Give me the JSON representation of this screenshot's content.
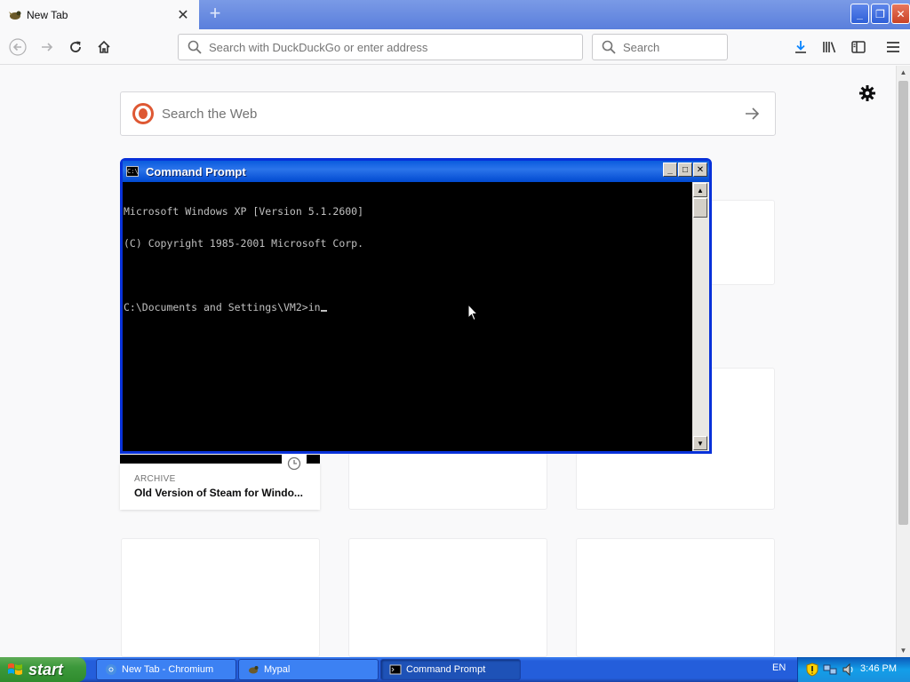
{
  "browser": {
    "tab": {
      "title": "New Tab"
    },
    "urlbar": {
      "placeholder": "Search with DuckDuckGo or enter address"
    },
    "searchbar": {
      "placeholder": "Search"
    }
  },
  "page": {
    "search_placeholder": "Search the Web",
    "card": {
      "tag": "ARCHIVE",
      "title": "Old Version of Steam for Windo..."
    }
  },
  "cmd": {
    "title": "Command Prompt",
    "icon_text": "C:\\",
    "lines": [
      "Microsoft Windows XP [Version 5.1.2600]",
      "(C) Copyright 1985-2001 Microsoft Corp.",
      "",
      "C:\\Documents and Settings\\VM2>in"
    ]
  },
  "taskbar": {
    "start_label": "start",
    "tasks": [
      {
        "label": "New Tab - Chromium",
        "icon": "chromium-icon"
      },
      {
        "label": "Mypal",
        "icon": "mypal-icon"
      },
      {
        "label": "Command Prompt",
        "icon": "cmd-icon"
      }
    ],
    "language": "EN",
    "clock": "3:46 PM"
  },
  "colors": {
    "xp_blue": "#245edb",
    "start_green": "#3c983b",
    "ddg_orange": "#de5833"
  }
}
